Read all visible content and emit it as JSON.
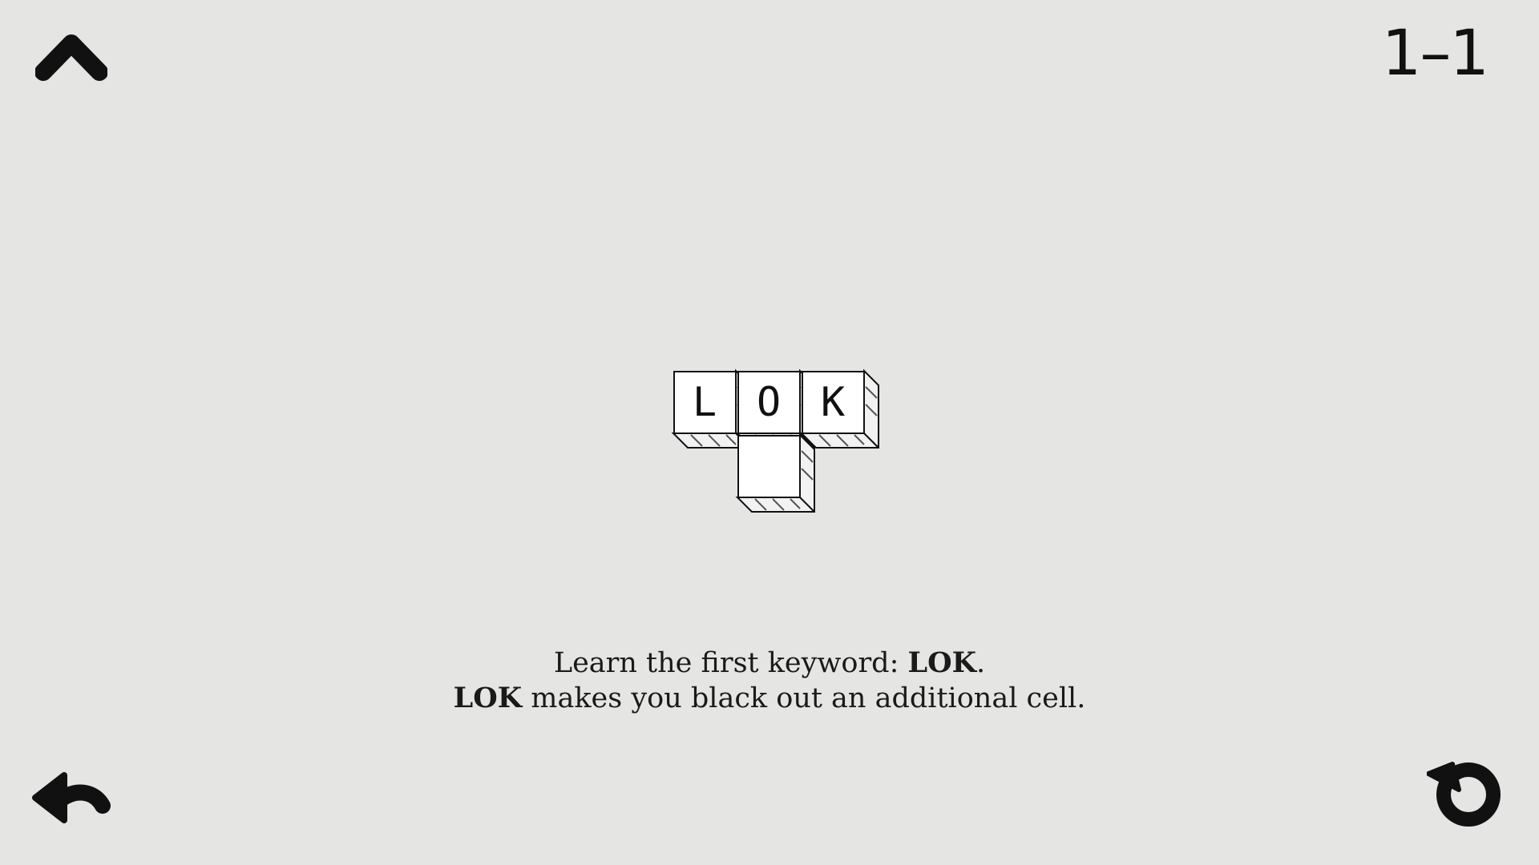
{
  "header": {
    "level": "1–1"
  },
  "board": {
    "cells": [
      {
        "letter": "L"
      },
      {
        "letter": "O"
      },
      {
        "letter": "K"
      },
      {
        "letter": ""
      }
    ]
  },
  "instructions": {
    "line1_prefix": "Learn the first keyword: ",
    "line1_keyword": "LOK",
    "line1_suffix": ".",
    "line2_keyword": "LOK",
    "line2_suffix": " makes you black out an additional cell."
  },
  "icons": {
    "menu": "chevron-up-icon",
    "undo": "undo-arrow-icon",
    "restart": "restart-icon"
  },
  "colors": {
    "background": "#e5e5e4",
    "ink": "#111111",
    "cell_face": "#ffffff"
  }
}
